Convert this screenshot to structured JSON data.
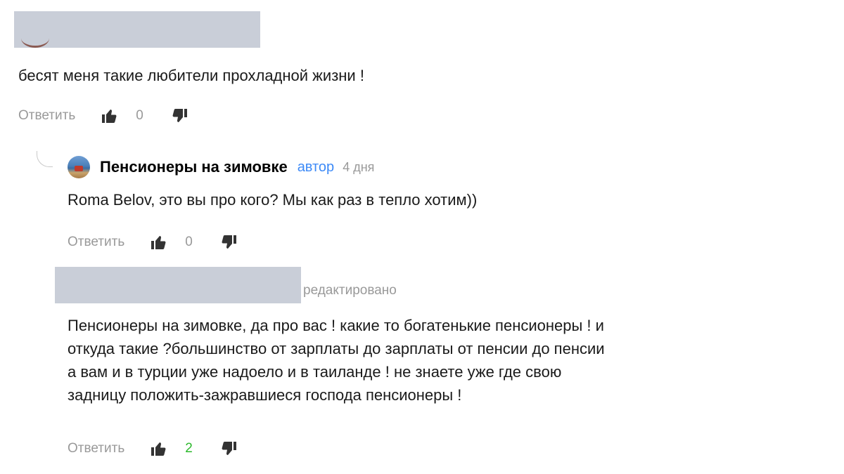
{
  "comments": {
    "top": {
      "text": "бесят меня такие любители прохладной жизни !",
      "actions": {
        "reply": "Ответить",
        "score": "0"
      }
    },
    "reply1": {
      "author": "Пенсионеры на зимовке",
      "badge": "автор",
      "time": "4 дня",
      "text": "Roma Belov, это вы про кого? Мы как раз в тепло хотим))",
      "actions": {
        "reply": "Ответить",
        "score": "0"
      }
    },
    "reply2": {
      "edited": "редактировано",
      "lines": [
        "Пенсионеры на зимовке, да про вас ! какие то богатенькие пенсионеры ! и",
        "откуда такие ?большинство от зарплаты до зарплаты от пенсии до пенсии",
        "а вам и в турции уже надоело и в таиланде ! не знаете уже где свою",
        "задницу положить-зажравшиеся господа пенсионеры !"
      ],
      "actions": {
        "reply": "Ответить",
        "score": "2"
      }
    }
  },
  "icons": {
    "like": "thumb-up-icon",
    "dislike": "thumb-down-icon",
    "avatar": "avatar"
  },
  "colors": {
    "author_badge": "#3d8af7",
    "positive_score": "#2db92d",
    "muted": "#999999",
    "redaction": "#c9ced8"
  }
}
